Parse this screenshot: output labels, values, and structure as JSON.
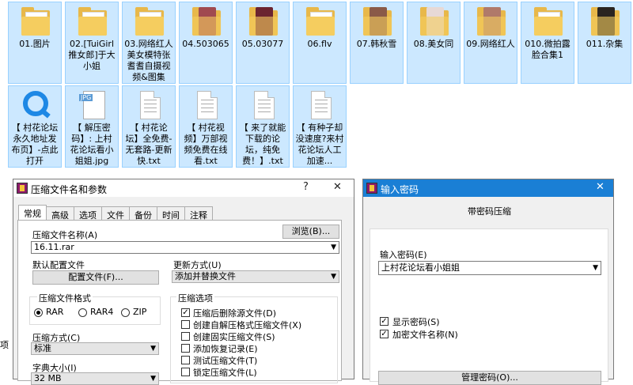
{
  "files": [
    {
      "label": "01.图片",
      "icon": "folder-icon"
    },
    {
      "label": "02.[TuiGirl推女郎]于大小姐",
      "icon": "folder-icon"
    },
    {
      "label": "03.网络红人美女模特张耆耆自摄视频&图集",
      "icon": "folder-icon"
    },
    {
      "label": "04.503065",
      "icon": "folder-photo-icon"
    },
    {
      "label": "05.03077",
      "icon": "folder-photo-icon"
    },
    {
      "label": "06.flv",
      "icon": "folder-icon"
    },
    {
      "label": "07.韩秋雪",
      "icon": "folder-photo-icon"
    },
    {
      "label": "08.美女同",
      "icon": "folder-photo-icon"
    },
    {
      "label": "09.网络红人",
      "icon": "folder-photo-icon"
    },
    {
      "label": "010.微拍露脸合集1",
      "icon": "folder-icon"
    },
    {
      "label": "011.杂集",
      "icon": "folder-photo-icon"
    },
    {
      "label": "【 村花论坛永久地址发布页】-点此打开",
      "icon": "browser-icon"
    },
    {
      "label": "【 解压密码】: 上村花论坛看小姐姐.jpg",
      "icon": "jpg-file-icon"
    },
    {
      "label": "【 村花论坛】全免费-无套路-更新快.txt",
      "icon": "text-file-icon"
    },
    {
      "label": "【 村花视频】万部视频免费在线看.txt",
      "icon": "text-file-icon"
    },
    {
      "label": "【 来了就能下载的论坛，纯免费！】.txt",
      "icon": "text-file-icon"
    },
    {
      "label": "【 有种子却没速度?来村花论坛人工加速...",
      "icon": "text-file-icon"
    }
  ],
  "left_edge_text": "项",
  "archive_dialog": {
    "title": "压缩文件名和参数",
    "help": "?",
    "tabs": [
      "常规",
      "高级",
      "选项",
      "文件",
      "备份",
      "时间",
      "注释"
    ],
    "archive_name_label": "压缩文件名称(A)",
    "browse_button": "浏览(B)...",
    "archive_name_value": "16.11.rar",
    "profile_label": "默认配置文件",
    "profile_button": "配置文件(F)...",
    "update_label": "更新方式(U)",
    "update_value": "添加并替换文件",
    "format_group": "压缩文件格式",
    "formats": [
      "RAR",
      "RAR4",
      "ZIP"
    ],
    "method_label": "压缩方式(C)",
    "method_value": "标准",
    "dict_label": "字典大小(I)",
    "dict_value": "32 MB",
    "options_group": "压缩选项",
    "options": [
      {
        "label": "压缩后删除源文件(D)",
        "checked": true
      },
      {
        "label": "创建自解压格式压缩文件(X)",
        "checked": false
      },
      {
        "label": "创建固实压缩文件(S)",
        "checked": false
      },
      {
        "label": "添加恢复记录(E)",
        "checked": false
      },
      {
        "label": "测试压缩文件(T)",
        "checked": false
      },
      {
        "label": "锁定压缩文件(L)",
        "checked": false
      }
    ]
  },
  "password_dialog": {
    "title": "输入密码",
    "heading": "带密码压缩",
    "password_label": "输入密码(E)",
    "password_value": "上村花论坛看小姐姐",
    "show_password": "显示密码(S)",
    "encrypt_names": "加密文件名称(N)",
    "manage_button": "管理密码(O)..."
  }
}
